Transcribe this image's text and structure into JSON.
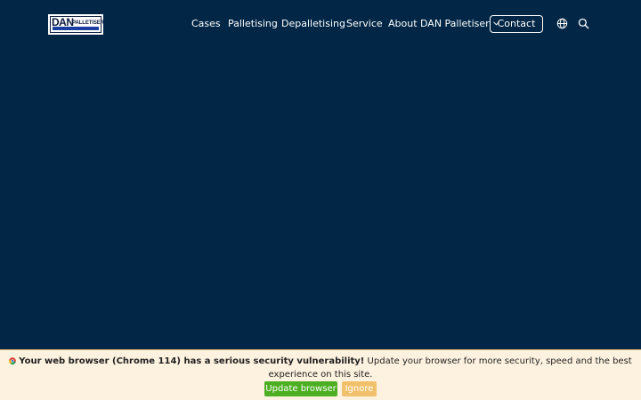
{
  "brand": {
    "logo_main": "DAN",
    "logo_sub": "PALLETISER",
    "logo_bar_color": "#1b3fa0",
    "background_color": "#022646"
  },
  "nav": {
    "items": [
      {
        "label": "Cases"
      },
      {
        "label": "Palletising"
      },
      {
        "label": "Depalletising"
      },
      {
        "label": "Service"
      },
      {
        "label": "About DAN Palletiser",
        "has_dropdown": true,
        "icon": "chevron-down-icon"
      }
    ],
    "contact_label": "Contact",
    "language_icon": "globe-icon",
    "search_icon": "search-icon"
  },
  "browser_update": {
    "icon": "chrome-icon",
    "warning_bold": "Your web browser (Chrome 114) has a serious security vulnerability!",
    "message": " Update your browser for more security, speed and the best experience on this site.",
    "update_label": "Update browser",
    "ignore_label": "Ignore",
    "update_color": "#4caf22",
    "ignore_color": "#f1c06b",
    "banner_color": "#fdf2df"
  }
}
